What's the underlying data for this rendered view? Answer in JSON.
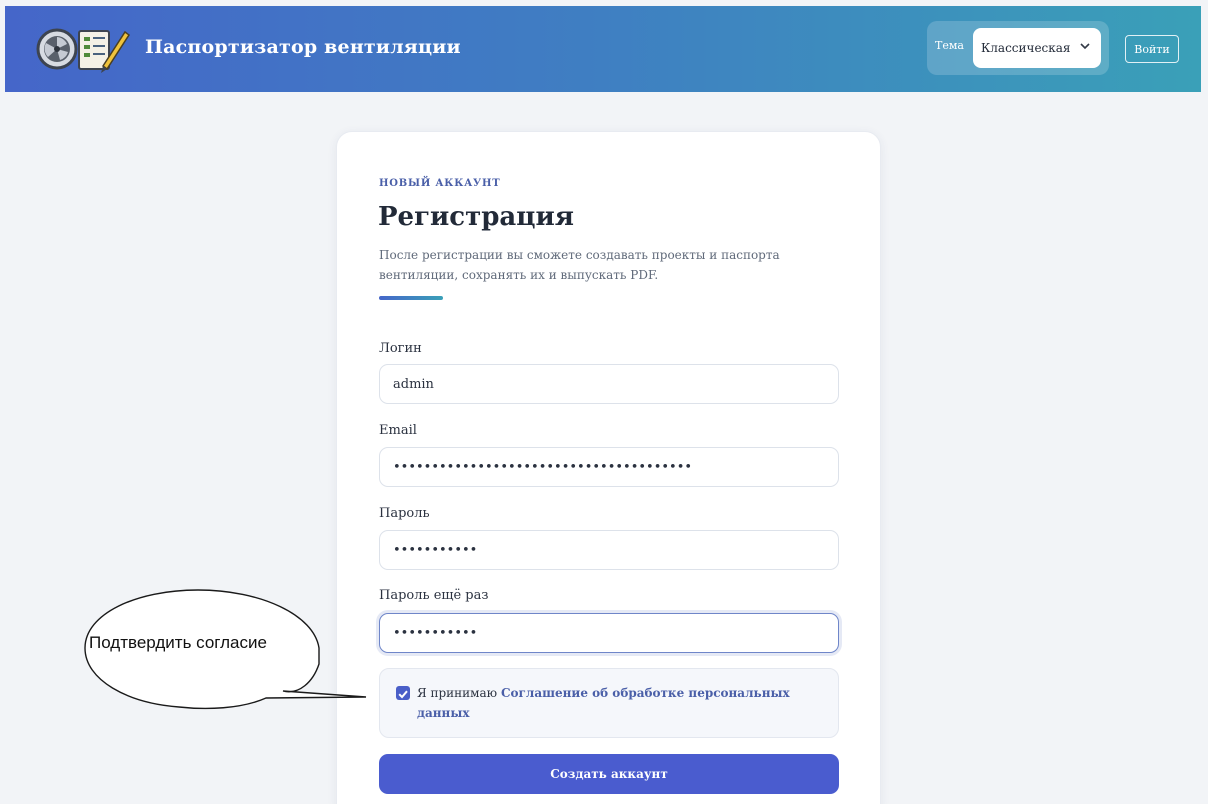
{
  "header": {
    "app_title": "Паспортизатор вентиляции",
    "theme_label": "Тема",
    "theme_value": "Классическая",
    "login_label": "Войти"
  },
  "form": {
    "eyebrow": "НОВЫЙ АККАУНТ",
    "title": "Регистрация",
    "description": "После регистрации вы сможете создавать проекты и паспорта вентиляции, сохранять их и выпускать PDF.",
    "fields": [
      {
        "label": "Логин",
        "value": "admin"
      },
      {
        "label": "Email",
        "value": "•••••••••••••••••••••••••••••••••••••••"
      },
      {
        "label": "Пароль",
        "value": "•••••••••••"
      },
      {
        "label": "Пароль ещё раз",
        "value": "•••••••••••"
      }
    ],
    "consent": {
      "checked": true,
      "prefix": "Я принимаю",
      "link": "Соглашение об обработке персональных данных"
    },
    "submit_label": "Создать аккаунт"
  },
  "callout": {
    "text": "Подтвердить согласие"
  },
  "colors": {
    "header_start": "#4566c9",
    "header_end": "#3aa0b8",
    "accent": "#4a5ccf",
    "link": "#4a5fa8"
  }
}
